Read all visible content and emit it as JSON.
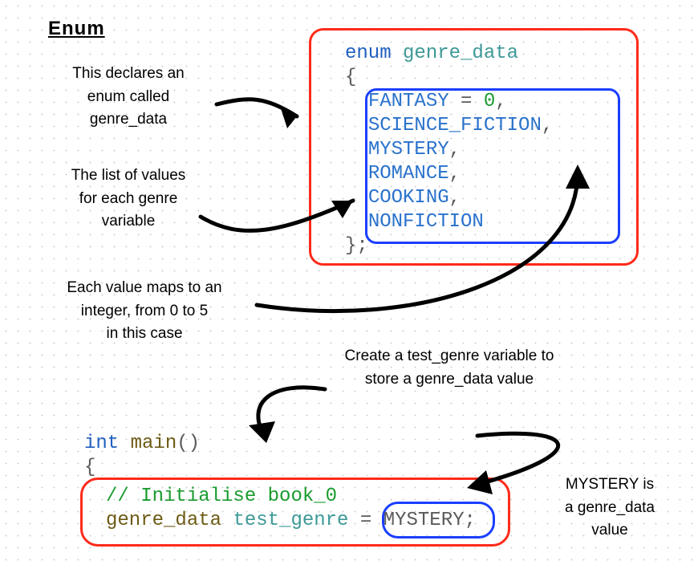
{
  "title": "Enum",
  "annots": {
    "a1_l1": "This declares an",
    "a1_l2": "enum called",
    "a1_l3": "genre_data",
    "a2_l1": "The list of values",
    "a2_l2": "for each genre",
    "a2_l3": "variable",
    "a3_l1": "Each value maps to an",
    "a3_l2": "integer, from 0 to 5",
    "a3_l3": "in this case",
    "a4_l1": "Create a test_genre variable to",
    "a4_l2": "store a genre_data value",
    "a5_l1": "MYSTERY is",
    "a5_l2": "a genre_data",
    "a5_l3": "value"
  },
  "code1": {
    "kw_enum": "enum",
    "name": "genre_data",
    "brace_open": "{",
    "v_fantasy": "FANTASY",
    "eq": " = ",
    "zero": "0",
    "comma": ",",
    "v_scifi": "SCIENCE_FICTION",
    "v_mystery": "MYSTERY",
    "v_romance": "ROMANCE",
    "v_cooking": "COOKING",
    "v_nonfiction": "NONFICTION",
    "brace_close": "};"
  },
  "code2": {
    "kw_int": "int",
    "fn_main": "main",
    "parens": "()",
    "brace_open": "{",
    "comment": "// Initialise book_0",
    "type_name": "genre_data",
    "var_name": "test_genre",
    "eq": " = ",
    "value": "MYSTERY",
    "semi": ";"
  }
}
